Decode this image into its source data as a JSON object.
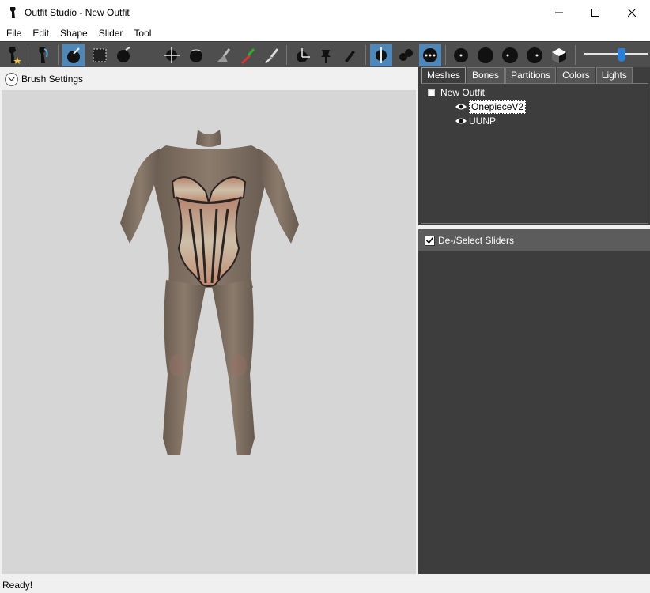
{
  "window": {
    "title": "Outfit Studio - New Outfit"
  },
  "menu": {
    "items": [
      "File",
      "Edit",
      "Shape",
      "Slider",
      "Tool"
    ]
  },
  "toolbar": {
    "icons": [
      "new-project-icon",
      "load-reference-icon",
      "select-brush-icon",
      "mask-icon",
      "inflate-icon",
      "deflate-icon",
      "move-icon",
      "smooth-icon",
      "undiff-icon",
      "weight-paint-icon",
      "color-paint-icon",
      "alpha-brush-icon",
      "transform-icon",
      "pivot-icon",
      "pencil-icon",
      "mirror-x-icon",
      "connected-icon",
      "vertex-mode-icon",
      "brush-size-icon",
      "brush-strength-icon",
      "brush-focus-icon",
      "brush-spacing-icon",
      "wireframe-icon"
    ],
    "slider_value": 0.6
  },
  "brush_settings": {
    "label": "Brush Settings"
  },
  "right_panel": {
    "tabs": [
      "Meshes",
      "Bones",
      "Partitions",
      "Colors",
      "Lights"
    ],
    "selected_tab": "Meshes",
    "tree": {
      "root": "New Outfit",
      "children": [
        "OnepieceV2",
        "UUNP"
      ],
      "selected_child": "OnepieceV2"
    }
  },
  "sliders": {
    "label": "De-/Select Sliders",
    "checked": true
  },
  "status": {
    "text": "Ready!"
  },
  "colors": {
    "toolbar_bg": "#4e4e4e",
    "active_tool": "#4f87b8",
    "panel_bg": "#3d3d3d",
    "viewport_bg": "#d6d6d6"
  }
}
